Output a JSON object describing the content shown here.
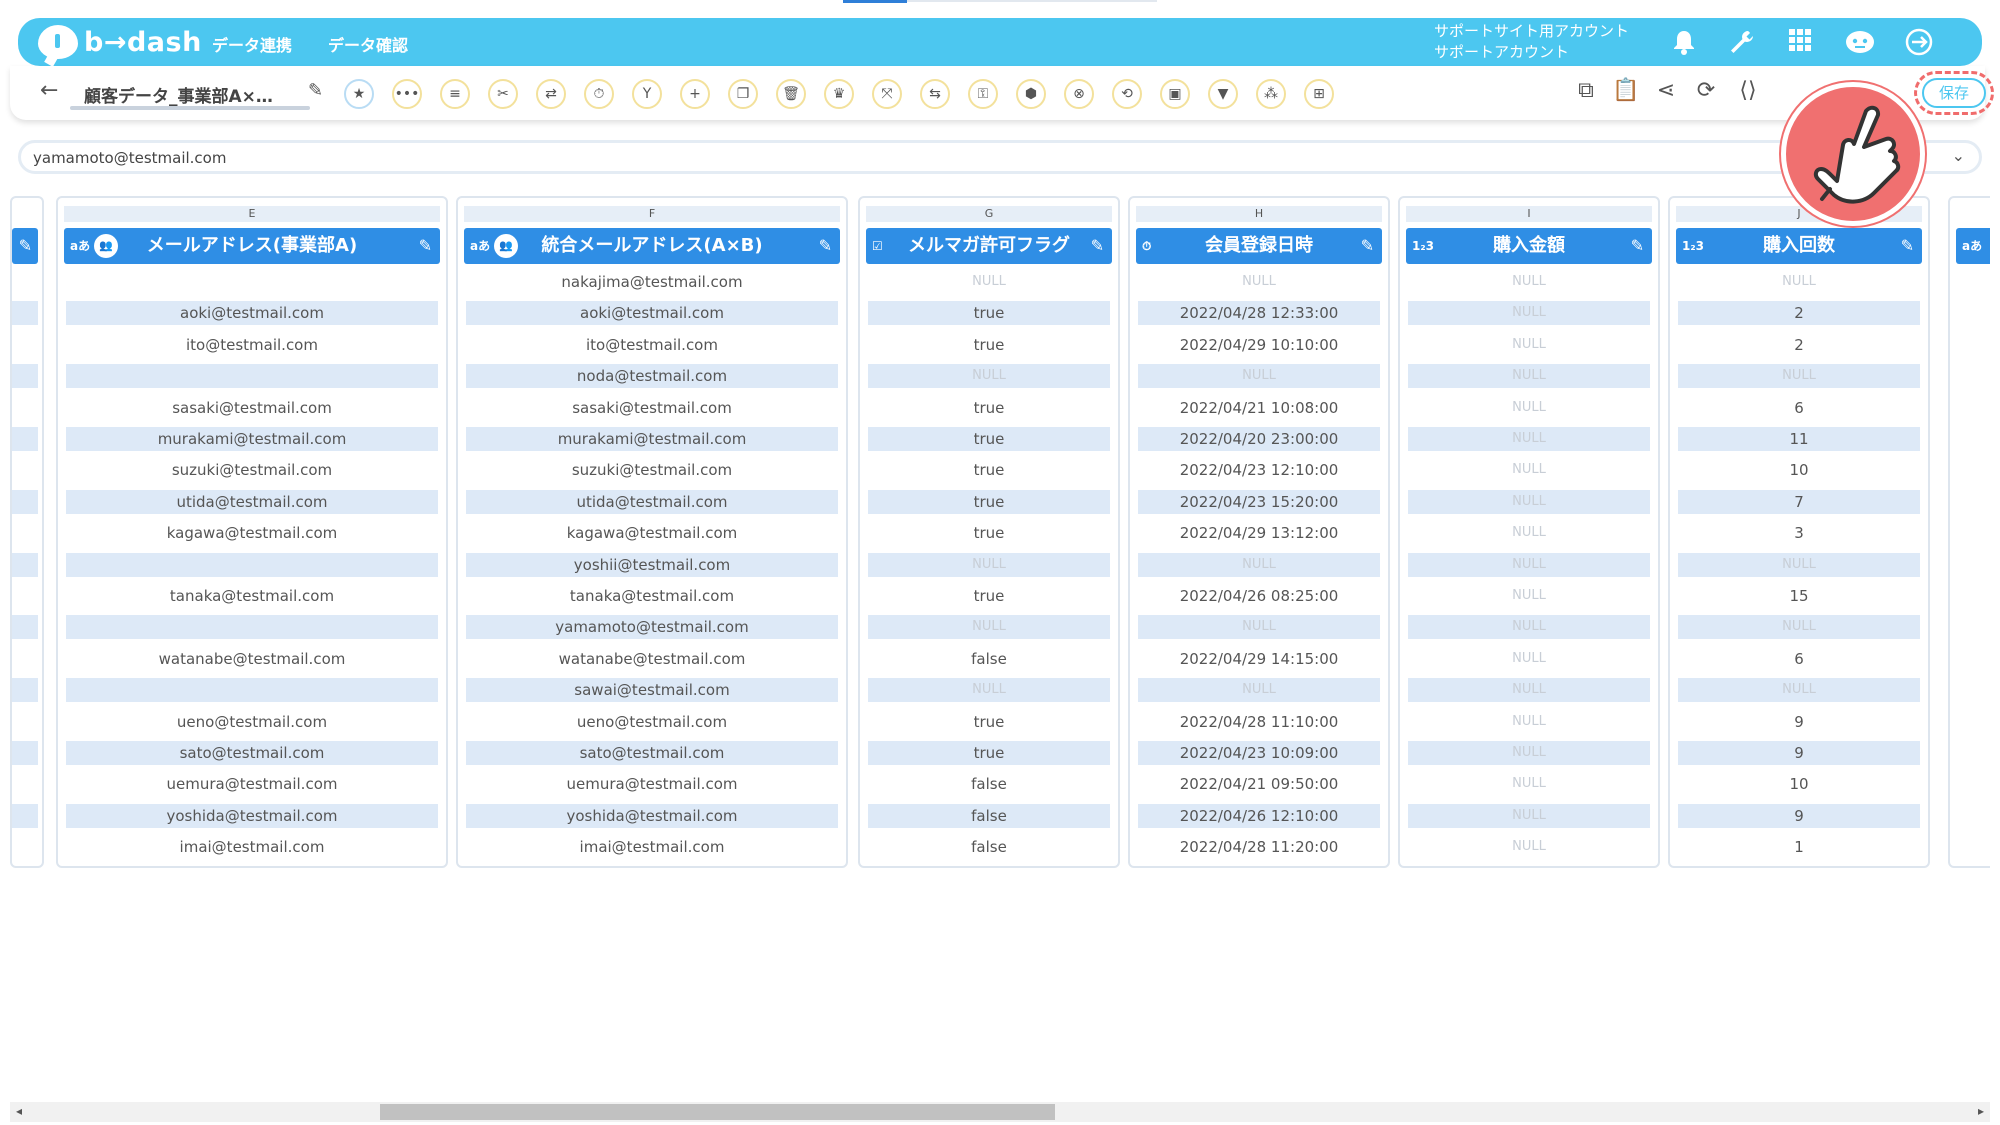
{
  "app": {
    "logo": "b→dash"
  },
  "header": {
    "nav": [
      "データ連携",
      "データ確認"
    ],
    "account_line1": "サポートサイト用アカウント",
    "account_line2": "サポートアカウント",
    "icons": [
      "bell-icon",
      "wrench-icon",
      "apps-grid-icon",
      "chat-robot-icon",
      "logout-icon"
    ]
  },
  "toolbar": {
    "flow_name": "顧客データ_事業部A×…",
    "save_label": "保存",
    "tools": [
      "star-icon",
      "more-icon",
      "list-icon",
      "cut-icon",
      "transform-icon",
      "timer-icon",
      "merge-icon",
      "add-icon",
      "copy-icon",
      "delete-icon",
      "crown-icon",
      "expand-icon",
      "swap-icon",
      "lock-icon",
      "box-icon",
      "cancel-icon",
      "convert-icon",
      "frame-icon",
      "filter-icon",
      "pattern-icon",
      "table-icon"
    ],
    "right_icons": [
      "diagram-icon",
      "clipboard-icon",
      "share-icon",
      "refresh-doc-icon",
      "code-icon"
    ]
  },
  "value_field": {
    "value": "yamamoto@testmail.com"
  },
  "columns": [
    {
      "letter": "E",
      "type": "aあ",
      "title": "メールアドレス(事業部A)",
      "cells": [
        "",
        "aoki@testmail.com",
        "ito@testmail.com",
        "",
        "sasaki@testmail.com",
        "murakami@testmail.com",
        "suzuki@testmail.com",
        "utida@testmail.com",
        "kagawa@testmail.com",
        "",
        "tanaka@testmail.com",
        "",
        "watanabe@testmail.com",
        "",
        "ueno@testmail.com",
        "sato@testmail.com",
        "uemura@testmail.com",
        "yoshida@testmail.com",
        "imai@testmail.com"
      ]
    },
    {
      "letter": "F",
      "type": "aあ",
      "title": "統合メールアドレス(A×B)",
      "cells": [
        "nakajima@testmail.com",
        "aoki@testmail.com",
        "ito@testmail.com",
        "noda@testmail.com",
        "sasaki@testmail.com",
        "murakami@testmail.com",
        "suzuki@testmail.com",
        "utida@testmail.com",
        "kagawa@testmail.com",
        "yoshii@testmail.com",
        "tanaka@testmail.com",
        "yamamoto@testmail.com",
        "watanabe@testmail.com",
        "sawai@testmail.com",
        "ueno@testmail.com",
        "sato@testmail.com",
        "uemura@testmail.com",
        "yoshida@testmail.com",
        "imai@testmail.com"
      ]
    },
    {
      "letter": "G",
      "type": "☑",
      "title": "メルマガ許可フラグ",
      "cells": [
        "NULL",
        "true",
        "true",
        "NULL",
        "true",
        "true",
        "true",
        "true",
        "true",
        "NULL",
        "true",
        "NULL",
        "false",
        "NULL",
        "true",
        "true",
        "false",
        "false",
        "false"
      ]
    },
    {
      "letter": "H",
      "type": "⏱",
      "title": "会員登録日時",
      "cells": [
        "NULL",
        "2022/04/28 12:33:00",
        "2022/04/29 10:10:00",
        "NULL",
        "2022/04/21 10:08:00",
        "2022/04/20 23:00:00",
        "2022/04/23 12:10:00",
        "2022/04/23 15:20:00",
        "2022/04/29 13:12:00",
        "NULL",
        "2022/04/26 08:25:00",
        "NULL",
        "2022/04/29 14:15:00",
        "NULL",
        "2022/04/28 11:10:00",
        "2022/04/23 10:09:00",
        "2022/04/21 09:50:00",
        "2022/04/26 12:10:00",
        "2022/04/28 11:20:00"
      ]
    },
    {
      "letter": "I",
      "type": "1₂3",
      "title": "購入金額",
      "cells": [
        "NULL",
        "NULL",
        "NULL",
        "NULL",
        "NULL",
        "NULL",
        "NULL",
        "NULL",
        "NULL",
        "NULL",
        "NULL",
        "NULL",
        "NULL",
        "NULL",
        "NULL",
        "NULL",
        "NULL",
        "NULL",
        "NULL"
      ]
    },
    {
      "letter": "J",
      "type": "1₂3",
      "title": "購入回数",
      "cells": [
        "NULL",
        "2",
        "2",
        "NULL",
        "6",
        "11",
        "10",
        "7",
        "3",
        "NULL",
        "15",
        "NULL",
        "6",
        "NULL",
        "9",
        "9",
        "10",
        "9",
        "1"
      ]
    }
  ],
  "colors": {
    "header_bg": "#4cc7f0",
    "column_header": "#2f8ee5",
    "row_alt": "#dde9f7",
    "save_border": "#f06c6c"
  }
}
